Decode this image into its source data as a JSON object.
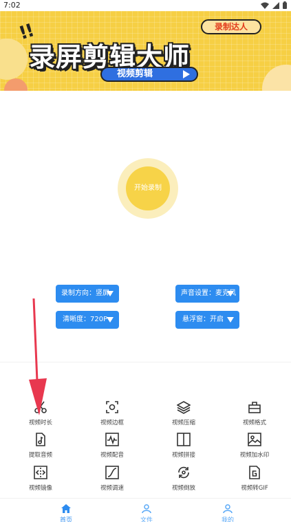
{
  "status_bar": {
    "time": "7:02"
  },
  "banner": {
    "badge": "录制达人",
    "title": "录屏剪辑大师",
    "subtitle": "视频剪辑",
    "dots": "!!"
  },
  "record": {
    "label": "开始录制"
  },
  "settings": {
    "direction": "录制方向：竖屏",
    "audio": "声音设置：麦克风",
    "quality": "清晰度：720P",
    "floating": "悬浮窗：开启"
  },
  "tools": [
    {
      "label": "视频时长",
      "icon": "scissors-icon"
    },
    {
      "label": "视频边框",
      "icon": "frame-icon"
    },
    {
      "label": "视频压缩",
      "icon": "layers-icon"
    },
    {
      "label": "视频格式",
      "icon": "toolbox-icon"
    },
    {
      "label": "提取音频",
      "icon": "music-file-icon"
    },
    {
      "label": "视频配音",
      "icon": "waveform-icon"
    },
    {
      "label": "视频拼接",
      "icon": "split-icon"
    },
    {
      "label": "视频加水印",
      "icon": "image-icon"
    },
    {
      "label": "视频镜像",
      "icon": "mirror-icon"
    },
    {
      "label": "视频调速",
      "icon": "speed-curve-icon"
    },
    {
      "label": "视频倒放",
      "icon": "rotate-icon"
    },
    {
      "label": "视频转GIF",
      "icon": "gif-icon"
    }
  ],
  "nav": {
    "home": "首页",
    "files": "文件",
    "mine": "我的"
  },
  "colors": {
    "accent": "#2d8cf0",
    "record": "#f7d348",
    "banner": "#f6cf44",
    "arrow": "#e8384f"
  }
}
